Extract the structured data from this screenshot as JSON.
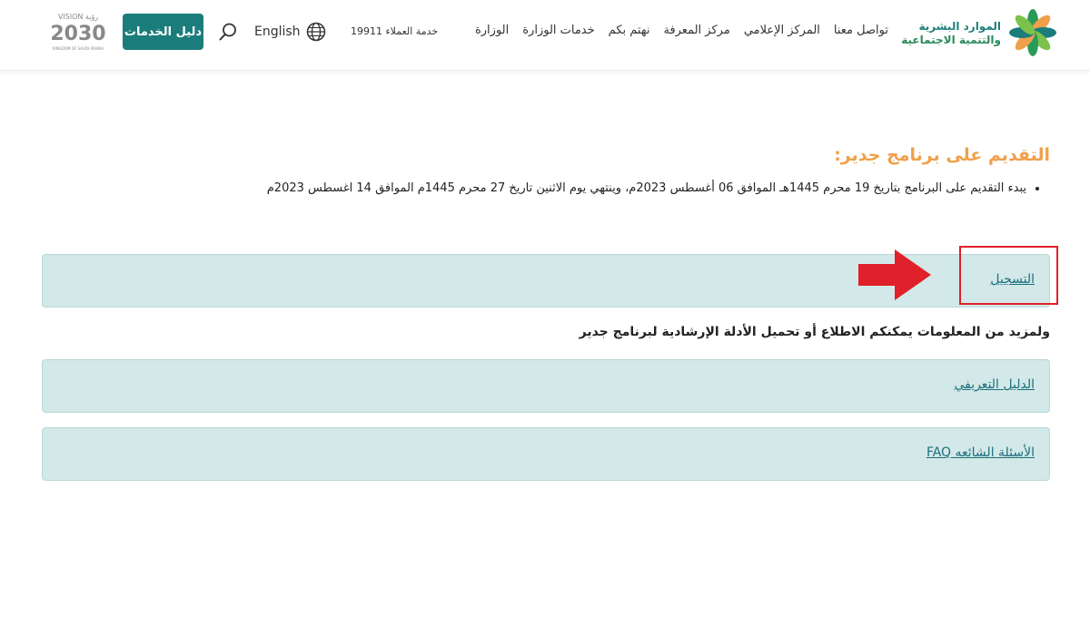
{
  "header": {
    "logo_text_line1": "الموارد البشرية",
    "logo_text_line2": "والتنمية الاجتماعية",
    "nav": [
      {
        "label": "الوزارة"
      },
      {
        "label": "خدمات الوزارة"
      },
      {
        "label": "نهتم بكم"
      },
      {
        "label": "مركز المعرفة"
      },
      {
        "label": "المركز الإعلامي"
      },
      {
        "label": "تواصل معنا"
      }
    ],
    "customer_service": "خدمة العملاء 19911",
    "language_label": "English",
    "services_button": "دليل الخدمات",
    "vision_top": "VISION رؤية",
    "vision_year": "2030",
    "vision_country": "KINGDOM OF SAUDI ARABIA",
    "colors": {
      "primary": "#1b7d7b",
      "accent": "#f0a04b",
      "highlight": "#e0202a"
    }
  },
  "notice": {
    "title": "التقديم على برنامج جدير:",
    "items": [
      "يبدء التقديم على البرنامج بتاريخ 19 محرم 1445هـ الموافق 06 أغسطس 2023م، وينتهي يوم الاثنين تاريخ 27 محرم 1445م الموافق 14 اغسطس 2023م"
    ]
  },
  "registration": {
    "link_label": "التسجيل"
  },
  "more_info": "ولمزيد من المعلومات يمكنكم الاطلاع أو تحميل الأدلة الإرشادية لبرنامج جدير",
  "guides": [
    {
      "label": "الدليل التعريفي"
    },
    {
      "label": "الأسئلة الشائعه FAQ"
    }
  ]
}
